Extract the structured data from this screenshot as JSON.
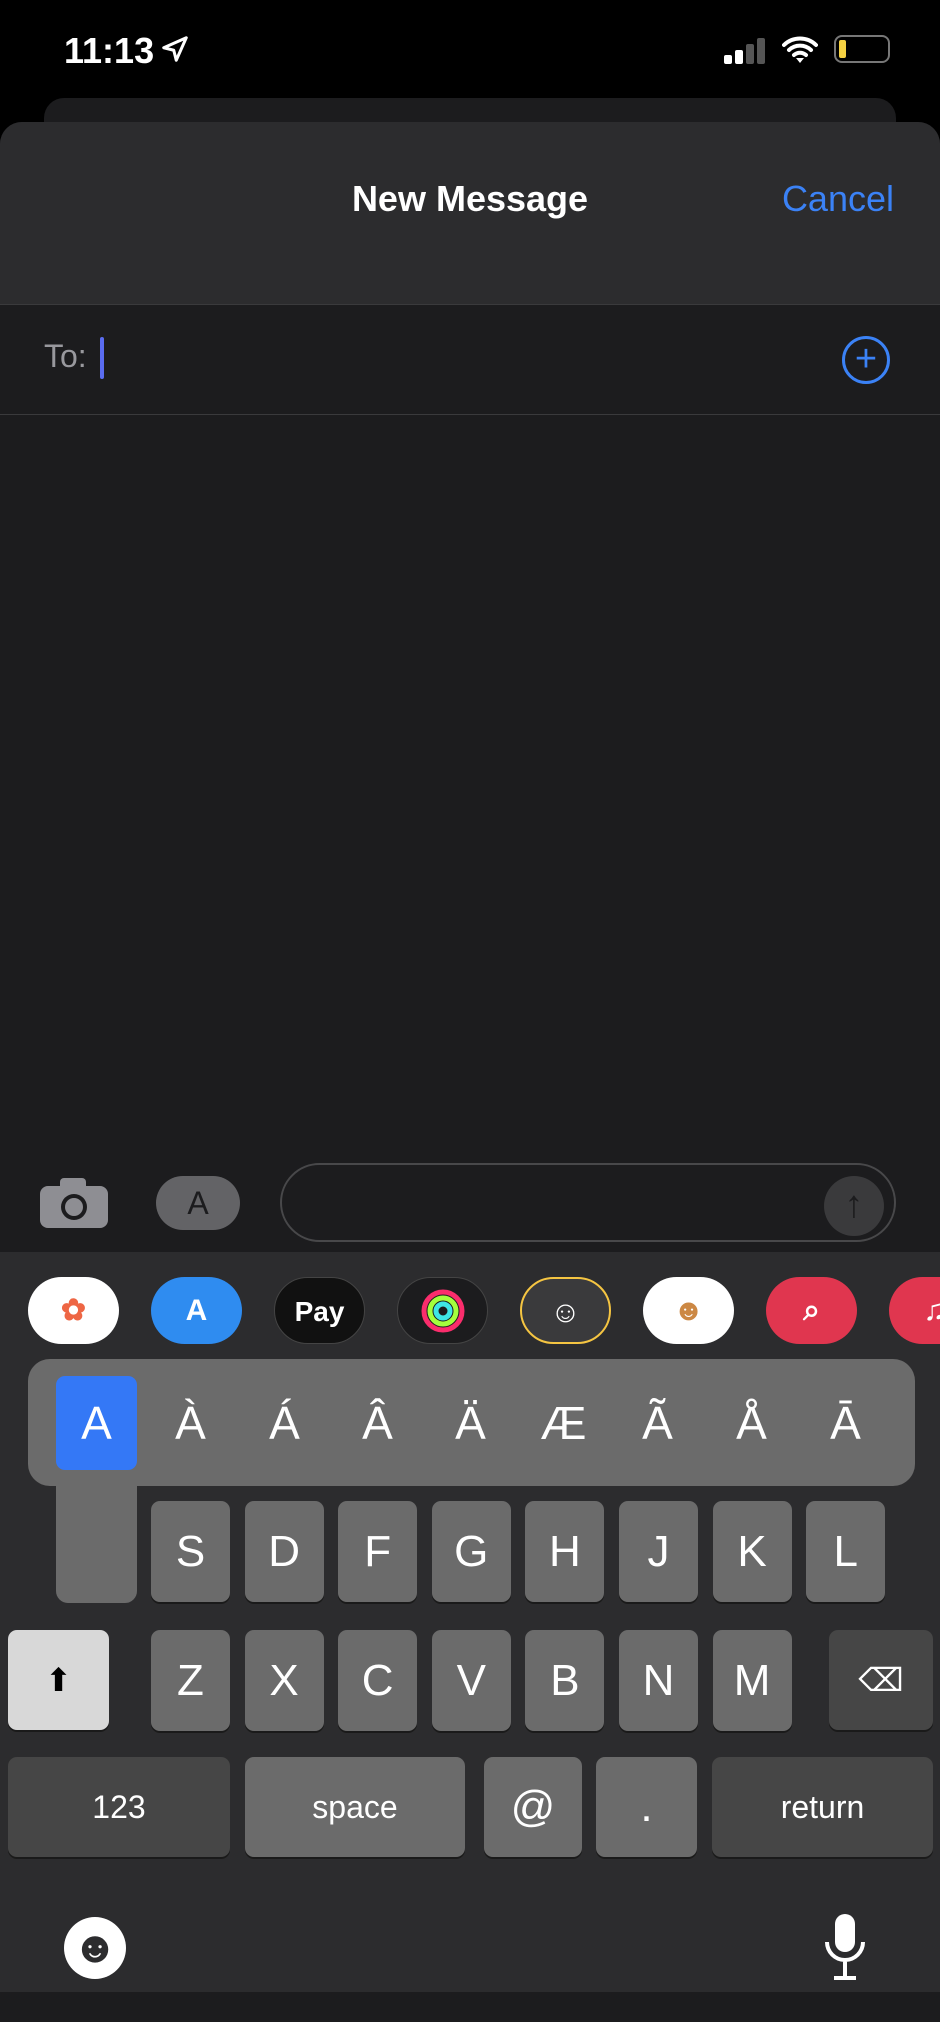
{
  "status_bar": {
    "time": "11:13",
    "location_icon": "location-arrow-icon",
    "signal_bars": 2,
    "battery_level": 0.15,
    "battery_color": "#f5d142"
  },
  "header": {
    "title": "New Message",
    "cancel_label": "Cancel"
  },
  "to_field": {
    "label": "To:",
    "value": ""
  },
  "compose": {
    "camera_icon": "camera-icon",
    "apps_icon": "app-store-icon",
    "send_icon": "arrow-up-icon",
    "message_value": ""
  },
  "app_strip": [
    {
      "name": "Photos",
      "icon": "photos-icon"
    },
    {
      "name": "App Store",
      "icon": "app-store-icon"
    },
    {
      "name": "Apple Pay",
      "icon": "apple-pay-icon",
      "label": "Pay"
    },
    {
      "name": "Activity",
      "icon": "activity-rings-icon"
    },
    {
      "name": "Memoji",
      "icon": "memoji-icon"
    },
    {
      "name": "Memoji Stickers",
      "icon": "memoji-stickers-icon"
    },
    {
      "name": "Search Images",
      "icon": "image-search-icon"
    },
    {
      "name": "Music",
      "icon": "music-icon"
    }
  ],
  "accent_popup": {
    "options": [
      "A",
      "À",
      "Á",
      "Â",
      "Ä",
      "Æ",
      "Ã",
      "Å",
      "Ā"
    ],
    "selected": "A"
  },
  "keyboard": {
    "row2": [
      "S",
      "D",
      "F",
      "G",
      "H",
      "J",
      "K",
      "L"
    ],
    "row3": [
      "Z",
      "X",
      "C",
      "V",
      "B",
      "N",
      "M"
    ],
    "numbers": "123",
    "space": "space",
    "at": "@",
    "period": ".",
    "return": "return",
    "accent_color": "#3478f6"
  }
}
